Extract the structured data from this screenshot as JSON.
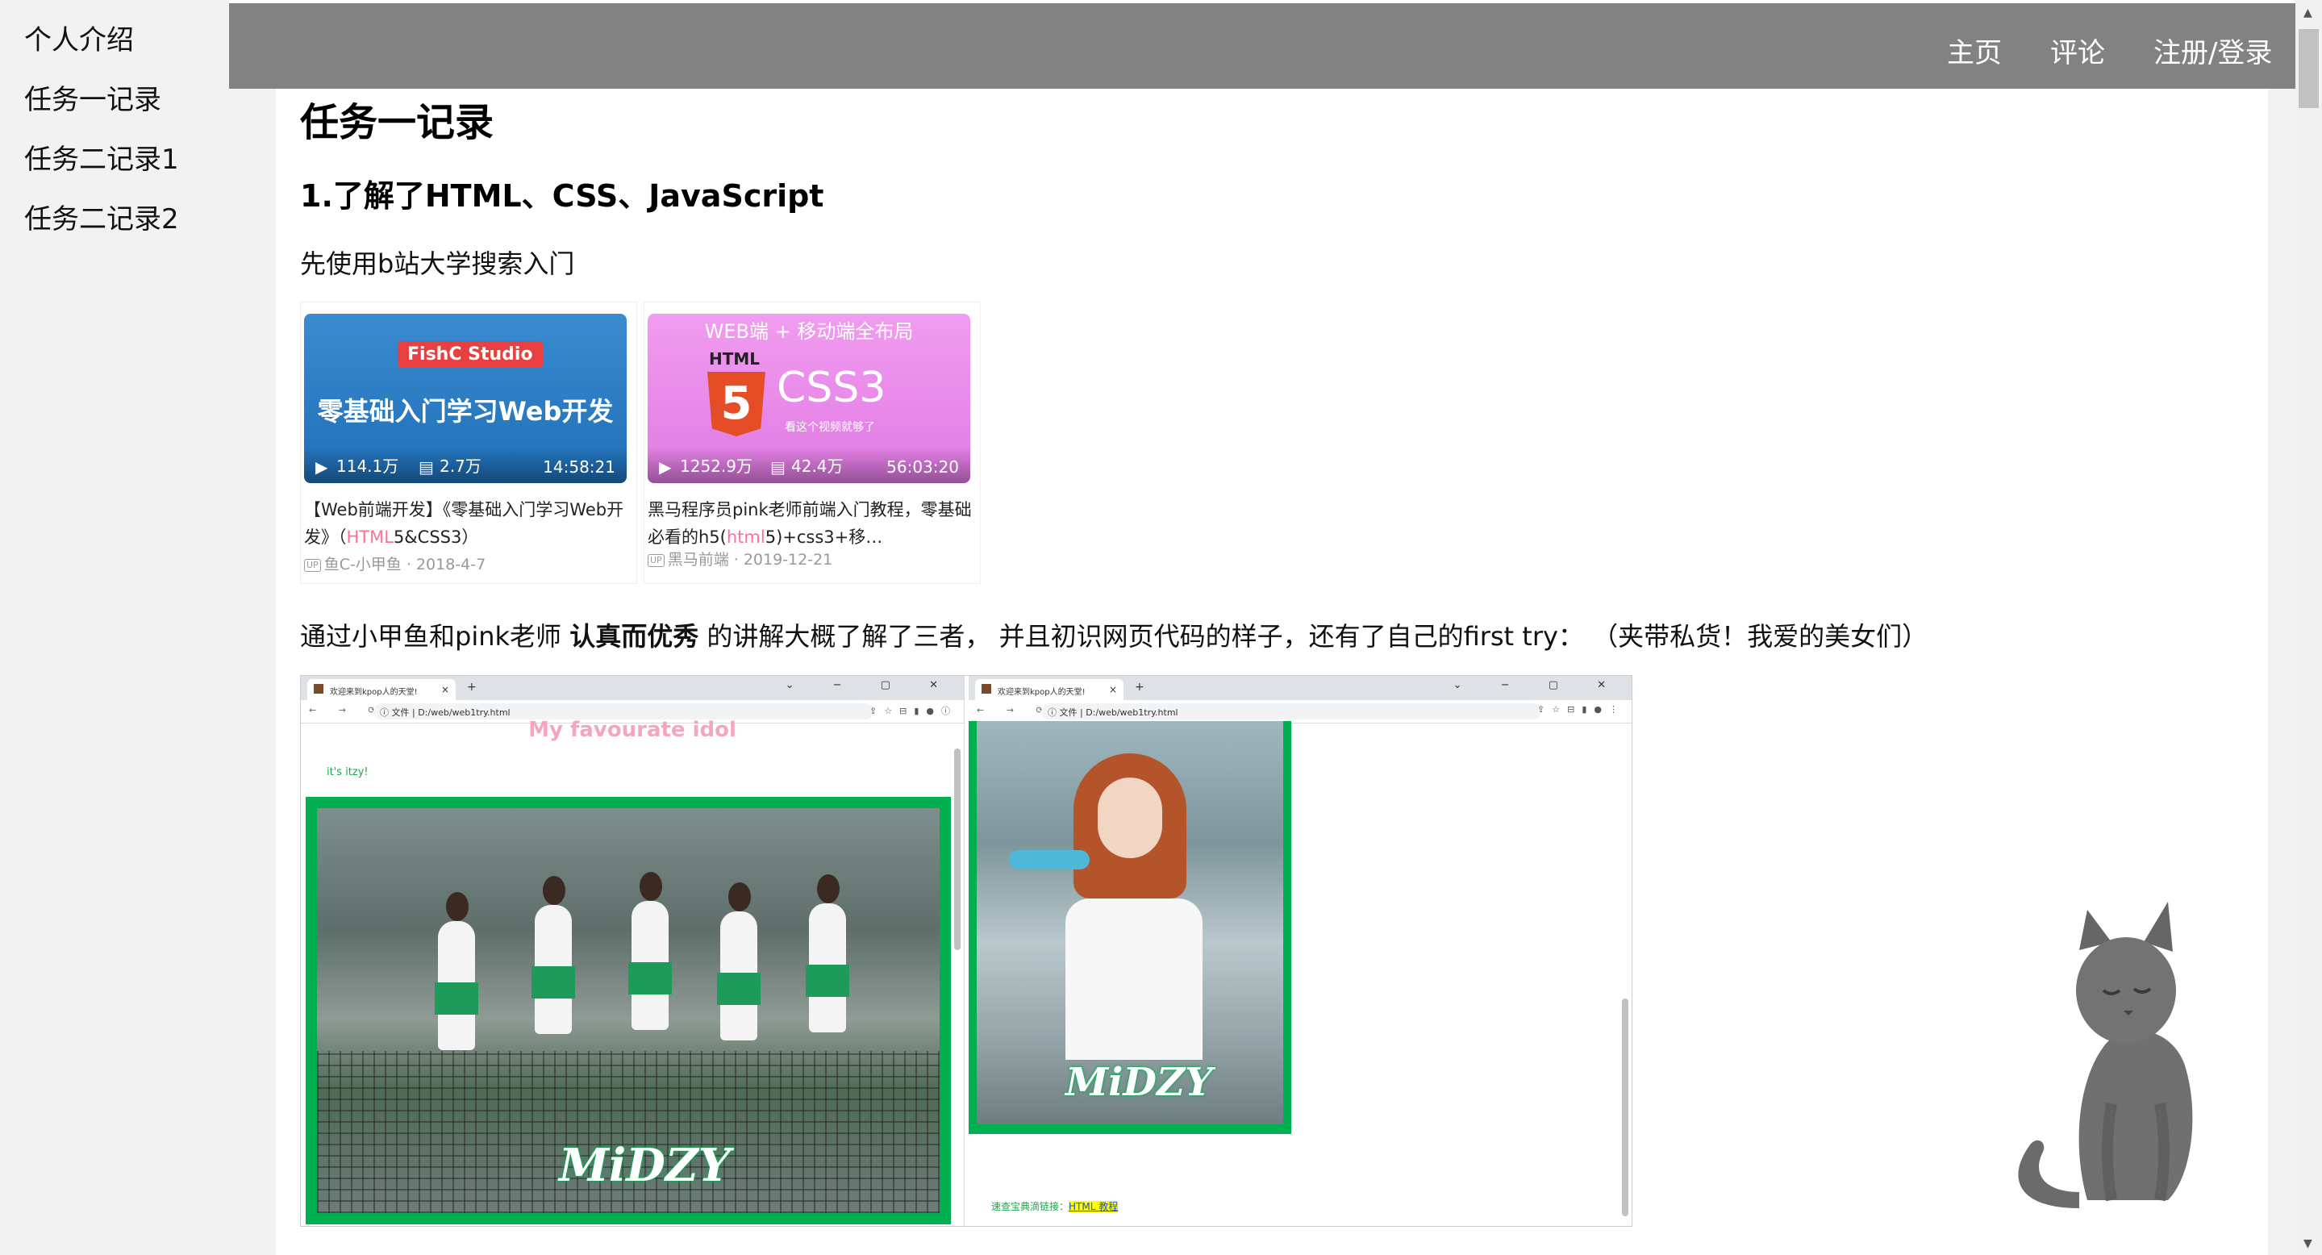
{
  "sidebar": {
    "items": [
      {
        "label": "个人介绍"
      },
      {
        "label": "任务一记录"
      },
      {
        "label": "任务二记录1"
      },
      {
        "label": "任务二记录2"
      }
    ]
  },
  "header": {
    "nav": [
      {
        "label": "主页"
      },
      {
        "label": "评论"
      },
      {
        "label": "注册/登录"
      }
    ]
  },
  "main": {
    "title": "任务一记录",
    "section_title": "1.了解了HTML、CSS、JavaScript",
    "intro": "先使用b站大学搜索入门",
    "videos": [
      {
        "badge": "FishC Studio",
        "headline": "零基础入门学习Web开发",
        "views": "114.1万",
        "danmaku": "2.7万",
        "duration": "14:58:21",
        "title_pre": "【Web前端开发】《零基础入门学习Web开发》（",
        "title_hl": "HTML",
        "title_post": "5&CSS3）",
        "up_badge": "UP",
        "uploader": "鱼C-小甲鱼",
        "date": "2018-4-7"
      },
      {
        "banner": "WEB端 + 移动端全布局",
        "html_label": "HTML",
        "shield": "5",
        "css3": "CSS3",
        "subline": "看这个视频就够了",
        "views": "1252.9万",
        "danmaku": "42.4万",
        "duration": "56:03:20",
        "title_pre": "黑马程序员pink老师前端入门教程，零基础必看的h5(",
        "title_hl": "html",
        "title_post": "5)+css3+移…",
        "up_badge": "UP",
        "uploader": "黑马前端",
        "date": "2019-12-21"
      }
    ],
    "para2": {
      "pre": "通过小甲鱼和pink老师 ",
      "bold": "认真而优秀",
      "post": " 的讲解大概了解了三者， 并且初识网页代码的样子，还有了自己的first try： （夹带私货！我爱的美女们）"
    },
    "screenshots": {
      "tab_label": "欢迎来到kpop人的天堂!",
      "tab_close": "×",
      "tab_plus": "+",
      "win_controls": "⌄ − ▢ ✕",
      "nav_arrows": "← → ⟳",
      "file_label": "ⓘ 文件",
      "url": "D:/web/web1try.html",
      "left_page": {
        "heading": "My favourate idol",
        "note": "it's itzy!",
        "logo": "MiDZY"
      },
      "right_page": {
        "logo": "MiDZY",
        "link_prefix": "速查宝典滴链接：",
        "link_text": "HTML 教程"
      }
    }
  },
  "colors": {
    "topbar": "#828282",
    "sidebar": "#f2f2f2",
    "green_frame": "#00b050",
    "highlight_pink": "#fb7299"
  }
}
